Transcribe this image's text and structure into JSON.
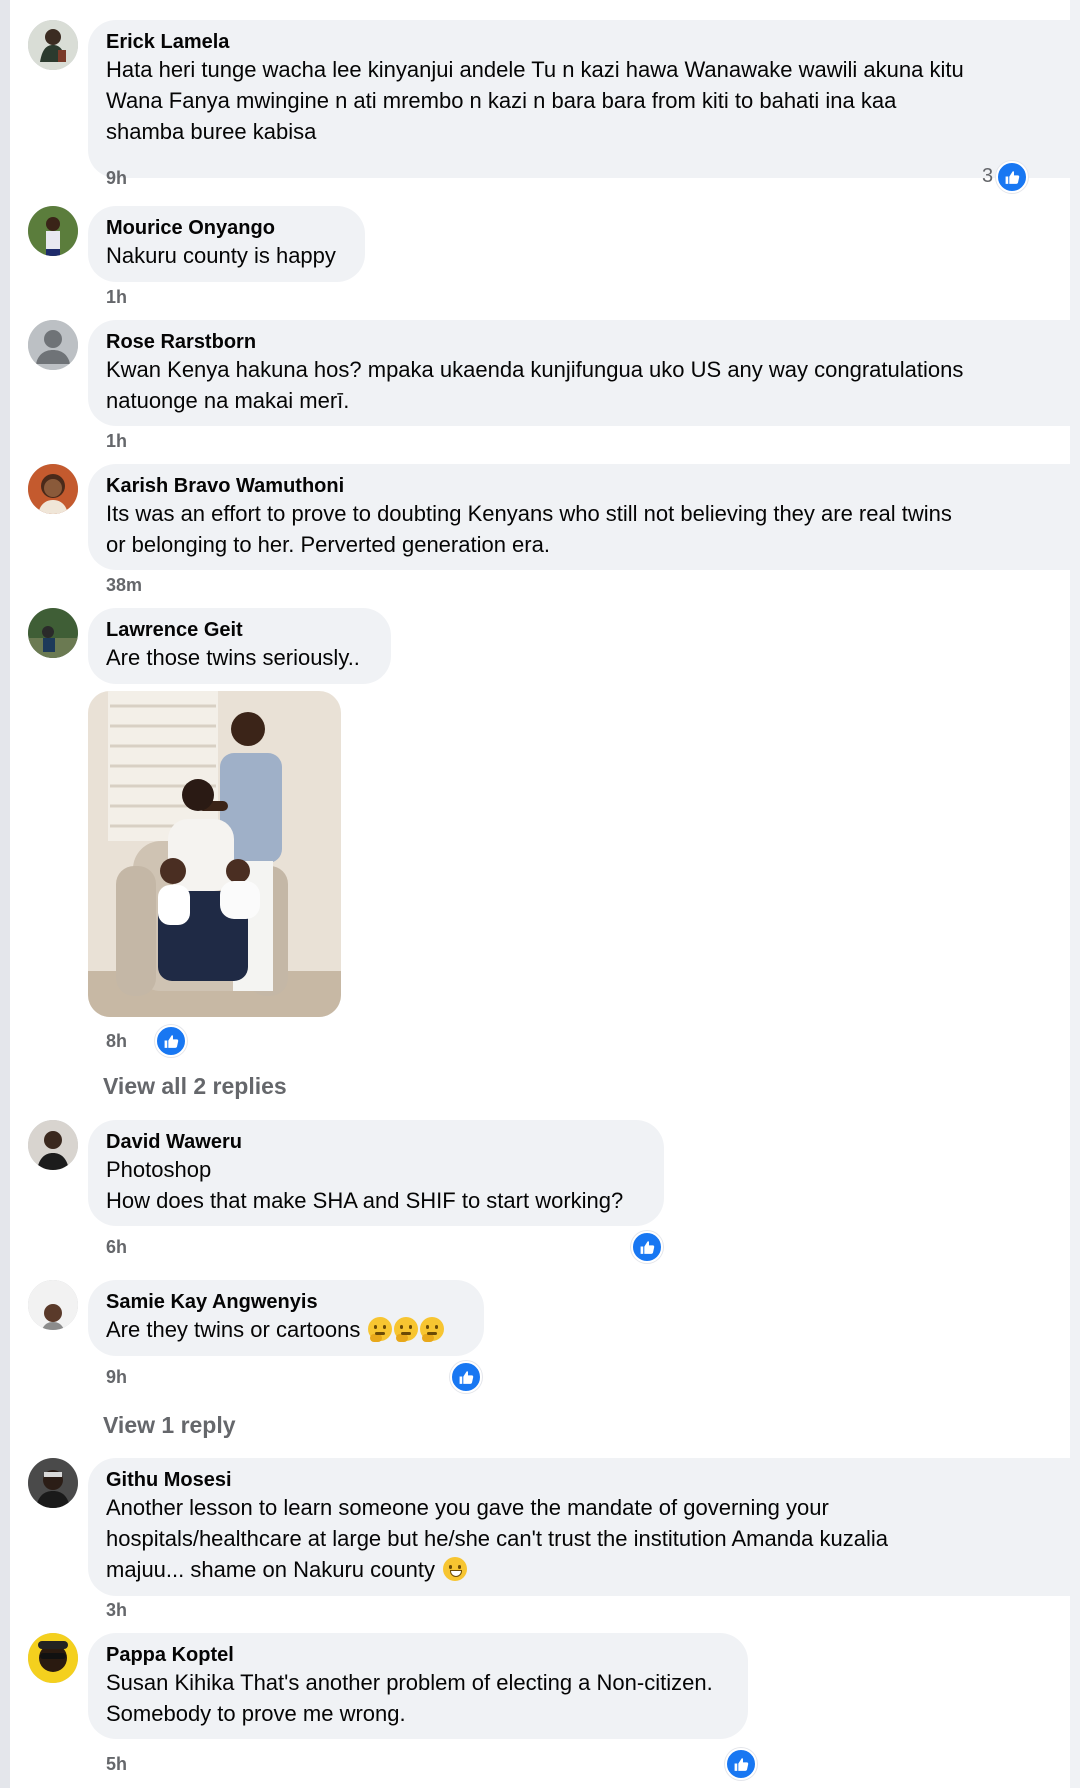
{
  "colors": {
    "bubble": "#f0f2f5",
    "accent": "#1877f2",
    "meta": "#65676b"
  },
  "comments": [
    {
      "author": "Erick Lamela",
      "lines": [
        "Hata heri tunge wacha lee kinyanjui andele Tu n kazi hawa Wanawake wawili akuna kitu",
        "Wana Fanya mwingine n ati mrembo n kazi n bara bara from kiti to bahati ina kaa",
        "shamba buree kabisa"
      ],
      "time": "9h",
      "reactions": "3",
      "avatar_icon": "profile-photo"
    },
    {
      "author": "Mourice Onyango",
      "lines": [
        "Nakuru county is happy"
      ],
      "time": "1h",
      "avatar_icon": "profile-photo"
    },
    {
      "author": "Rose Rarstborn",
      "lines": [
        "Kwan Kenya hakuna hos? mpaka ukaenda kunjifungua uko US any way congratulations",
        "natuonge na makai merī."
      ],
      "time": "1h",
      "avatar_icon": "default-avatar-icon"
    },
    {
      "author": "Karish Bravo Wamuthoni",
      "lines": [
        "Its was an effort to prove to doubting Kenyans who still not believing they are real twins",
        "or belonging to her. Perverted generation era."
      ],
      "time": "38m",
      "avatar_icon": "profile-photo"
    },
    {
      "author": "Lawrence Geit",
      "lines": [
        "Are those twins seriously.."
      ],
      "time": "8h",
      "replies": "View all 2 replies",
      "avatar_icon": "profile-photo"
    },
    {
      "author": "David Waweru",
      "lines": [
        "Photoshop",
        "How does that make SHA and SHIF to start working?"
      ],
      "time": "6h",
      "avatar_icon": "profile-photo"
    },
    {
      "author": "Samie Kay Angwenyis",
      "lines": [
        "Are they twins or cartoons"
      ],
      "time": "9h",
      "replies": "View 1 reply",
      "avatar_icon": "profile-photo",
      "emoji": "thinking-face-emoji x3"
    },
    {
      "author": "Githu Mosesi",
      "lines": [
        "Another lesson to learn someone you gave the mandate of governing your",
        "hospitals/healthcare at large but he/she can't trust the institution Amanda kuzalia",
        "majuu... shame on Nakuru county"
      ],
      "time": "3h",
      "avatar_icon": "profile-photo",
      "emoji": "grinning-sweat-emoji"
    },
    {
      "author": "Pappa Koptel",
      "lines": [
        "Susan Kihika That's another problem of electing a Non-citizen.",
        "Somebody to prove me wrong."
      ],
      "time": "5h",
      "avatar_icon": "profile-photo"
    }
  ]
}
